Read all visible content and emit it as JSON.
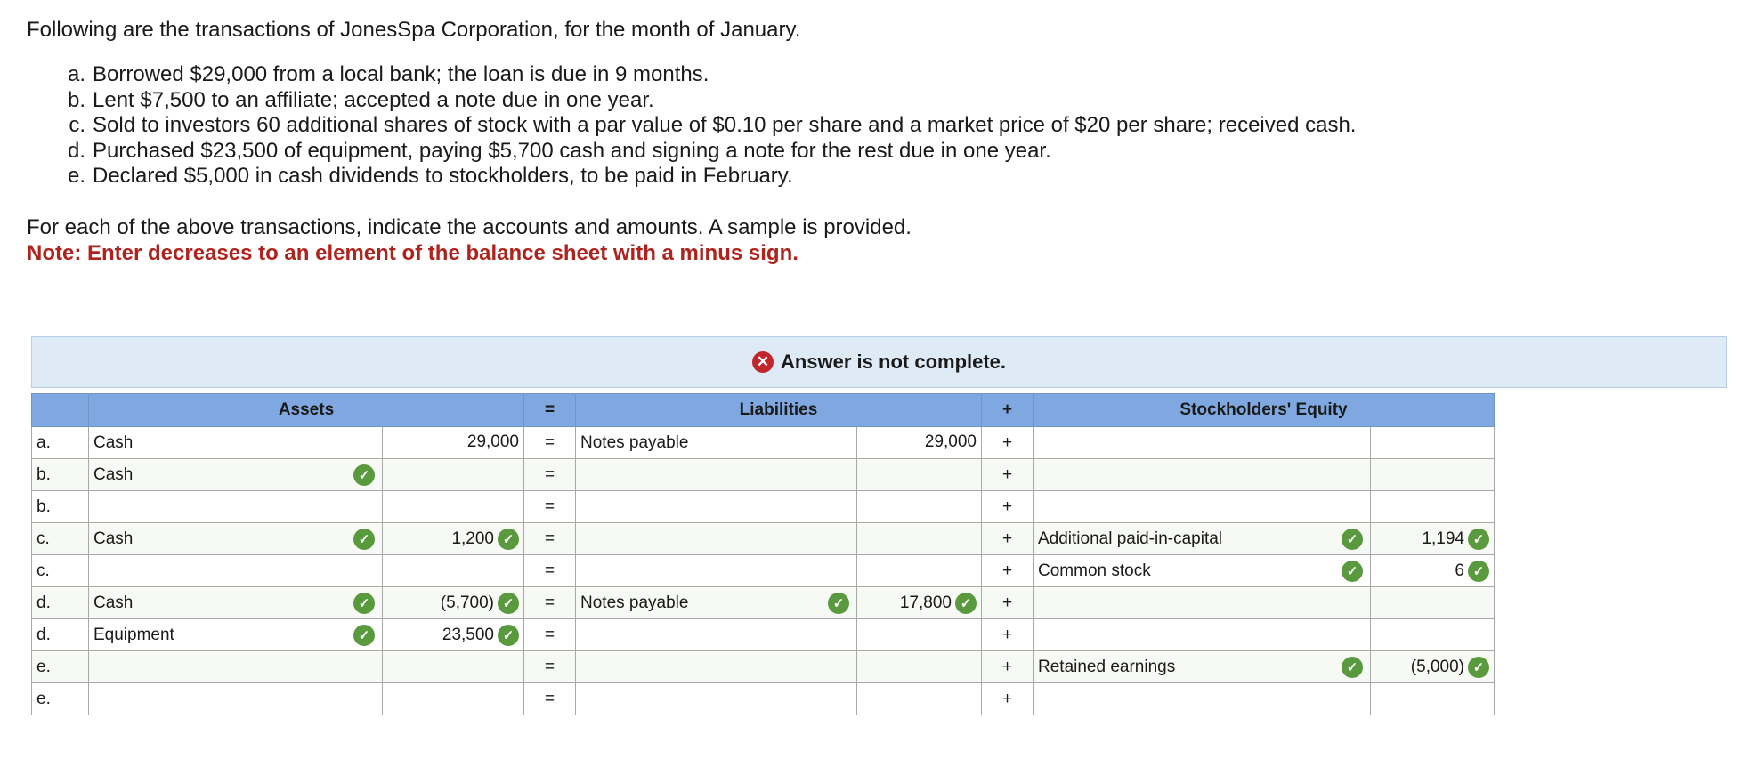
{
  "intro": "Following are the transactions of JonesSpa Corporation, for the month of January.",
  "transactions": [
    {
      "letter": "a.",
      "text": "Borrowed $29,000 from a local bank; the loan is due in 9 months."
    },
    {
      "letter": "b.",
      "text": "Lent $7,500 to an affiliate; accepted a note due in one year."
    },
    {
      "letter": "c.",
      "text": "Sold to investors 60 additional shares of stock with a par value of $0.10 per share and a market price of $20 per share; received cash."
    },
    {
      "letter": "d.",
      "text": "Purchased $23,500 of equipment, paying $5,700 cash and signing a note for the rest due in one year."
    },
    {
      "letter": "e.",
      "text": "Declared $5,000 in cash dividends to stockholders, to be paid in February."
    }
  ],
  "instruction": "For each of the above transactions, indicate the accounts and amounts. A sample is provided.",
  "note": "Note: Enter decreases to an element of the balance sheet with a minus sign.",
  "banner": {
    "text": "Answer is not complete.",
    "icon": "x-circle-icon"
  },
  "colors": {
    "header_blue": "#7fa8e0",
    "check_green": "#5a9a3e",
    "error_red": "#c0272d",
    "note_red": "#b0221c",
    "banner_bg": "#dfeaf7"
  },
  "table": {
    "headers": {
      "assets": "Assets",
      "eq": "=",
      "liabilities": "Liabilities",
      "plus": "+",
      "equity": "Stockholders' Equity"
    },
    "rows": [
      {
        "label": "a.",
        "asset_account": "Cash",
        "asset_account_check": false,
        "asset_amount": "29,000",
        "asset_amount_check": false,
        "eq": "=",
        "liab_account": "Notes payable",
        "liab_account_check": false,
        "liab_amount": "29,000",
        "liab_amount_check": false,
        "plus": "+",
        "equity_account": "",
        "equity_account_check": false,
        "equity_amount": "",
        "equity_amount_check": false
      },
      {
        "label": "b.",
        "asset_account": "Cash",
        "asset_account_check": true,
        "asset_amount": "",
        "asset_amount_check": false,
        "eq": "=",
        "liab_account": "",
        "liab_account_check": false,
        "liab_amount": "",
        "liab_amount_check": false,
        "plus": "+",
        "equity_account": "",
        "equity_account_check": false,
        "equity_amount": "",
        "equity_amount_check": false
      },
      {
        "label": "b.",
        "asset_account": "",
        "asset_account_check": false,
        "asset_amount": "",
        "asset_amount_check": false,
        "eq": "=",
        "liab_account": "",
        "liab_account_check": false,
        "liab_amount": "",
        "liab_amount_check": false,
        "plus": "+",
        "equity_account": "",
        "equity_account_check": false,
        "equity_amount": "",
        "equity_amount_check": false
      },
      {
        "label": "c.",
        "asset_account": "Cash",
        "asset_account_check": true,
        "asset_amount": "1,200",
        "asset_amount_check": true,
        "eq": "=",
        "liab_account": "",
        "liab_account_check": false,
        "liab_amount": "",
        "liab_amount_check": false,
        "plus": "+",
        "equity_account": "Additional paid-in-capital",
        "equity_account_check": true,
        "equity_amount": "1,194",
        "equity_amount_check": true
      },
      {
        "label": "c.",
        "asset_account": "",
        "asset_account_check": false,
        "asset_amount": "",
        "asset_amount_check": false,
        "eq": "=",
        "liab_account": "",
        "liab_account_check": false,
        "liab_amount": "",
        "liab_amount_check": false,
        "plus": "+",
        "equity_account": "Common stock",
        "equity_account_check": true,
        "equity_amount": "6",
        "equity_amount_check": true
      },
      {
        "label": "d.",
        "asset_account": "Cash",
        "asset_account_check": true,
        "asset_amount": "(5,700)",
        "asset_amount_check": true,
        "eq": "=",
        "liab_account": "Notes payable",
        "liab_account_check": true,
        "liab_amount": "17,800",
        "liab_amount_check": true,
        "plus": "+",
        "equity_account": "",
        "equity_account_check": false,
        "equity_amount": "",
        "equity_amount_check": false
      },
      {
        "label": "d.",
        "asset_account": "Equipment",
        "asset_account_check": true,
        "asset_amount": "23,500",
        "asset_amount_check": true,
        "eq": "=",
        "liab_account": "",
        "liab_account_check": false,
        "liab_amount": "",
        "liab_amount_check": false,
        "plus": "+",
        "equity_account": "",
        "equity_account_check": false,
        "equity_amount": "",
        "equity_amount_check": false
      },
      {
        "label": "e.",
        "asset_account": "",
        "asset_account_check": false,
        "asset_amount": "",
        "asset_amount_check": false,
        "eq": "=",
        "liab_account": "",
        "liab_account_check": false,
        "liab_amount": "",
        "liab_amount_check": false,
        "plus": "+",
        "equity_account": "Retained earnings",
        "equity_account_check": true,
        "equity_amount": "(5,000)",
        "equity_amount_check": true
      },
      {
        "label": "e.",
        "asset_account": "",
        "asset_account_check": false,
        "asset_amount": "",
        "asset_amount_check": false,
        "eq": "=",
        "liab_account": "",
        "liab_account_check": false,
        "liab_amount": "",
        "liab_amount_check": false,
        "plus": "+",
        "equity_account": "",
        "equity_account_check": false,
        "equity_amount": "",
        "equity_amount_check": false
      }
    ]
  }
}
